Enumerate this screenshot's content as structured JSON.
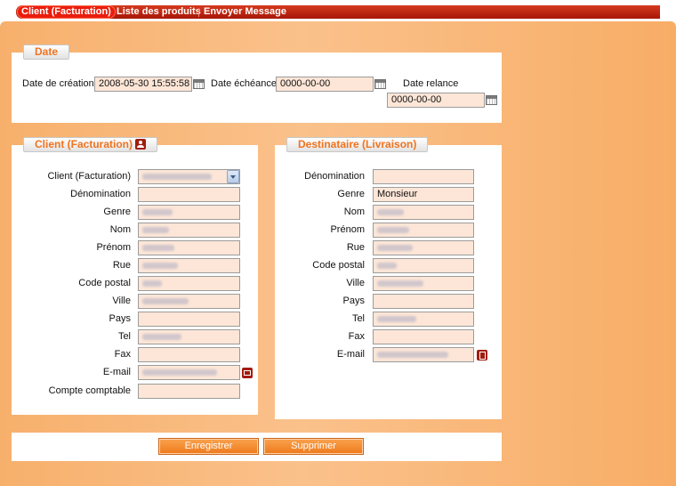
{
  "tabs": [
    {
      "label": "Client (Facturation)",
      "active": true
    },
    {
      "label": "Liste des produits",
      "active": false
    },
    {
      "label": "Envoyer Message",
      "active": false
    }
  ],
  "date_section": {
    "title": "Date",
    "creation_label": "Date de création",
    "creation_value": "2008-05-30 15:55:58",
    "echeance_label": "Date échéance",
    "echeance_value": "0000-00-00",
    "relance_label": "Date relance",
    "relance_value": "0000-00-00"
  },
  "client": {
    "title": "Client (Facturation)",
    "select_label": "Client (Facturation)",
    "denomination_label": "Dénomination",
    "genre_label": "Genre",
    "nom_label": "Nom",
    "prenom_label": "Prénom",
    "rue_label": "Rue",
    "code_postal_label": "Code postal",
    "ville_label": "Ville",
    "pays_label": "Pays",
    "tel_label": "Tel",
    "fax_label": "Fax",
    "email_label": "E-mail",
    "compte_label": "Compte comptable"
  },
  "destinataire": {
    "title": "Destinataire (Livraison)",
    "denomination_label": "Dénomination",
    "genre_label": "Genre",
    "genre_value": "Monsieur",
    "nom_label": "Nom",
    "prenom_label": "Prénom",
    "rue_label": "Rue",
    "code_postal_label": "Code postal",
    "ville_label": "Ville",
    "pays_label": "Pays",
    "tel_label": "Tel",
    "fax_label": "Fax",
    "email_label": "E-mail"
  },
  "buttons": {
    "save": "Enregistrer",
    "delete": "Supprimer"
  }
}
